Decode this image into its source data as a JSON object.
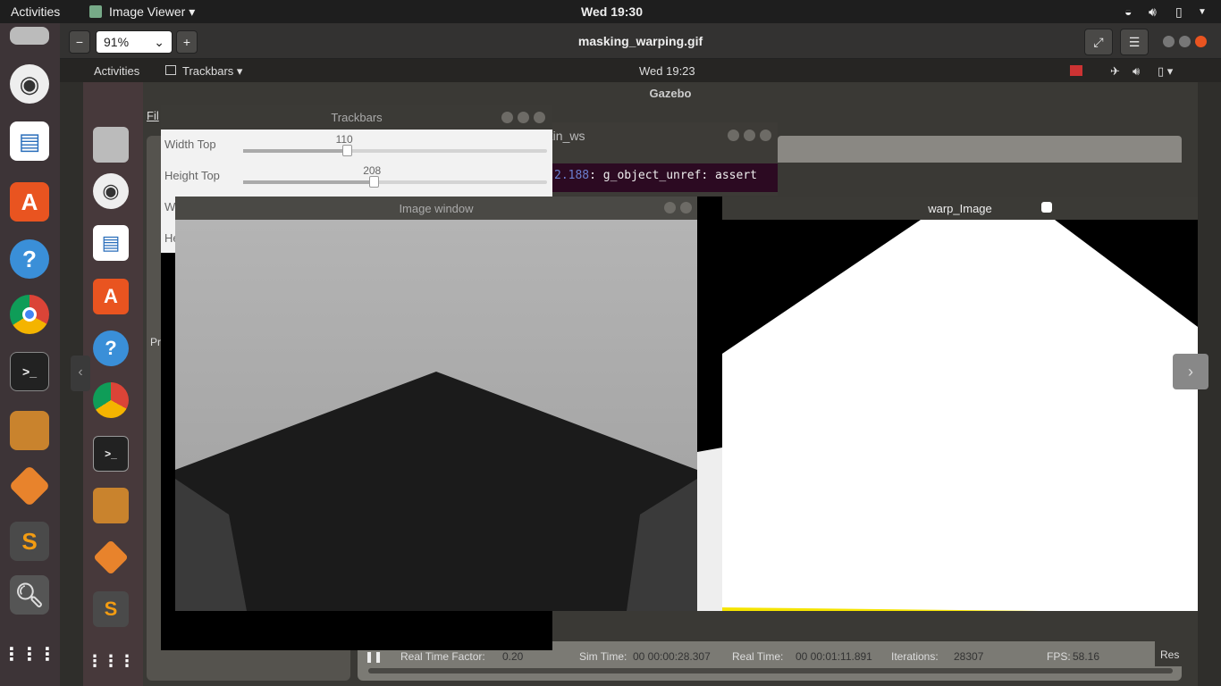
{
  "topbar": {
    "activities": "Activities",
    "app": "Image Viewer ▾",
    "clock": "Wed 19:30",
    "icons": [
      "wifi-icon",
      "volume-icon",
      "battery-icon",
      "menu-arrow-icon"
    ]
  },
  "viewer": {
    "zoom_out": "−",
    "zoom": "91%",
    "zoom_in": "+",
    "title": "masking_warping.gif",
    "fullscreen": "⤢",
    "menu": "☰"
  },
  "inner": {
    "topbar": {
      "activities": "Activities",
      "app": "Trackbars ▾",
      "clock": "Wed 19:23"
    },
    "gazebo": {
      "title": "Gazebo",
      "menu_file": "Fil",
      "left_label": "Pr",
      "status": {
        "rtf_label": "Real Time Factor:",
        "rtf": "0.20",
        "sim_label": "Sim Time:",
        "sim": "00 00:00:28.307",
        "real_label": "Real Time:",
        "real": "00 00:01:11.891",
        "iter_label": "Iterations:",
        "iter": "28307",
        "fps_label": "FPS:",
        "fps": "58.16",
        "reset": "Res"
      }
    },
    "trackbars": {
      "title": "Trackbars",
      "sliders": [
        {
          "label": "Width Top",
          "value": "110",
          "fraction": 0.34
        },
        {
          "label": "Height Top",
          "value": "208",
          "fraction": 0.43
        },
        {
          "label": "W",
          "value": ""
        },
        {
          "label": "He",
          "value": ""
        }
      ]
    },
    "terminal": {
      "title": "atkin_ws",
      "line_num": "2.188",
      "line": ": g_object_unref: assert"
    },
    "image_window": {
      "title": "Image window"
    },
    "warp_window": {
      "title": "warp_Image"
    }
  }
}
